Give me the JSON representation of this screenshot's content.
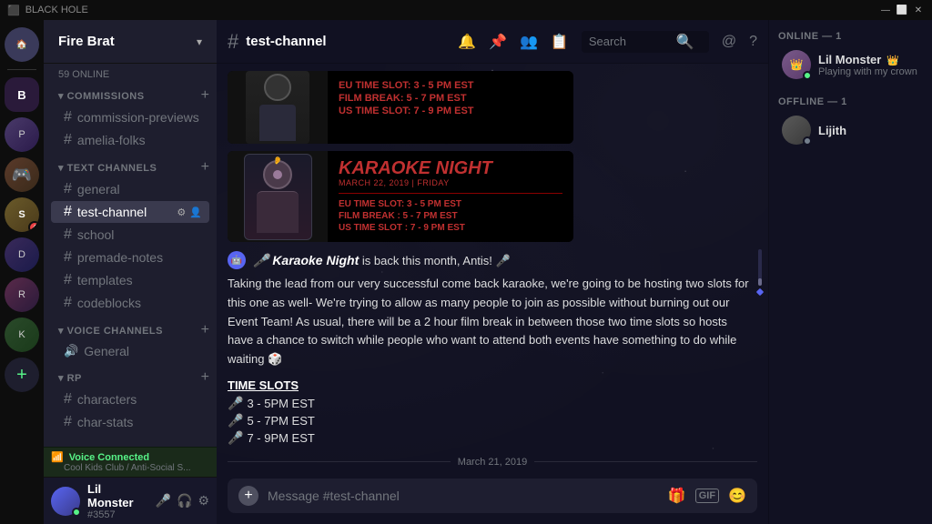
{
  "titlebar": {
    "title": "BLACK HOLE",
    "controls": [
      "—",
      "⬜",
      "✕"
    ]
  },
  "server_list": {
    "servers": [
      {
        "id": "home",
        "icon": "🏠",
        "active": false
      },
      {
        "id": "s1",
        "icon": "B",
        "active": true,
        "color": "#2a1a3a"
      },
      {
        "id": "s2",
        "icon": "P",
        "active": false,
        "color": "#1a2a2a"
      },
      {
        "id": "s3",
        "icon": "🎮",
        "active": false,
        "color": "#3a1a1a"
      },
      {
        "id": "s4",
        "icon": "S",
        "active": false,
        "color": "#2a2a1a",
        "badge": "4"
      },
      {
        "id": "s5",
        "icon": "D",
        "active": false,
        "color": "#1a1a3a"
      },
      {
        "id": "s6",
        "icon": "R",
        "active": false,
        "color": "#2a1a2a"
      },
      {
        "id": "s7",
        "icon": "K",
        "active": false,
        "color": "#1a2a1a"
      },
      {
        "id": "add",
        "icon": "+",
        "active": false
      }
    ]
  },
  "sidebar": {
    "server_name": "Fire Brat",
    "online_count": "59 ONLINE",
    "sections": [
      {
        "label": "COMMISSIONS",
        "channels": [
          {
            "name": "commission-previews",
            "hash": "#"
          },
          {
            "name": "amelia-folks",
            "hash": "#"
          }
        ]
      },
      {
        "label": "TEXT CHANNELS",
        "channels": [
          {
            "name": "general",
            "hash": "#"
          },
          {
            "name": "test-channel",
            "hash": "#",
            "active": true
          },
          {
            "name": "school",
            "hash": "#"
          },
          {
            "name": "premade-notes",
            "hash": "#"
          },
          {
            "name": "templates",
            "hash": "#"
          },
          {
            "name": "codeblocks",
            "hash": "#"
          }
        ]
      },
      {
        "label": "VOICE CHANNELS",
        "channels": [
          {
            "name": "General",
            "hash": "🔊"
          }
        ]
      },
      {
        "label": "RP",
        "channels": [
          {
            "name": "characters",
            "hash": "#"
          },
          {
            "name": "char-stats",
            "hash": "#"
          }
        ]
      }
    ]
  },
  "user_panel": {
    "name": "Lil Monster",
    "tag": "#3557",
    "status": "online"
  },
  "chat_header": {
    "channel": "test-channel",
    "search_placeholder": "Search"
  },
  "messages": {
    "karaoke_poster_1": {
      "slots": [
        "EU TIME SLOT: 3 - 5 PM EST",
        "FILM BREAK: 5 - 7 PM EST",
        "US TIME SLOT: 7 - 9 PM EST"
      ]
    },
    "karaoke_poster_2": {
      "title": "KARAOKE NIGHT",
      "date": "MARCH 22, 2019 | FRIDAY",
      "slots": [
        "EU TIME SLOT: 3 - 5 PM EST",
        "FILM BREAK: 5 - 7 PM EST",
        "US TIME SLOT: 7 - 9 PM EST"
      ]
    },
    "intro_text": "Karaoke Night is back this month, Antis!",
    "body_text": "Taking the lead from our very successful come back karaoke, we're going to be hosting two slots for this one as well- We're trying to allow as many people to join as possible without burning out our Event Team! As usual, there will be a 2 hour film break in between those two time slots so hosts have a chance to switch while people who want to attend both events have something to do while waiting",
    "time_slots_title": "TIME SLOTS",
    "slots_list": [
      "3 - 5PM EST",
      "5 - 7PM EST",
      "7 - 9PM EST"
    ],
    "date_divider": "March 21, 2019"
  },
  "chat_input": {
    "placeholder": "Message #test-channel"
  },
  "right_sidebar": {
    "online_label": "ONLINE — 1",
    "offline_label": "OFFLINE — 1",
    "members": [
      {
        "name": "Lil Monster",
        "status": "online",
        "status_text": "Playing with my crown",
        "crown": true
      },
      {
        "name": "Lijith",
        "status": "offline",
        "status_text": ""
      }
    ]
  },
  "voice_bar": {
    "status": "Voice Connected",
    "channel": "Cool Kids Club / Anti-Social S..."
  }
}
